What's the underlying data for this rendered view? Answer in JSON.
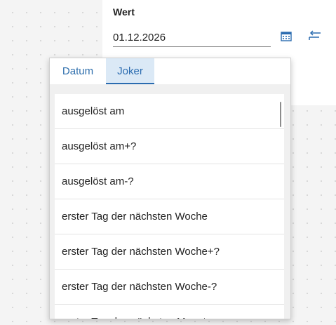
{
  "field": {
    "label": "Wert",
    "value": "01.12.2026"
  },
  "icons": {
    "calendar": "calendar-icon",
    "swap": "swap-arrow-icon"
  },
  "colors": {
    "accent": "#2b6cb0",
    "active_tab_bg": "#dbe9f6"
  },
  "popup": {
    "tabs": [
      {
        "label": "Datum",
        "active": false
      },
      {
        "label": "Joker",
        "active": true
      }
    ],
    "items": [
      "ausgelöst am",
      "ausgelöst am+?",
      "ausgelöst am-?",
      "erster Tag der nächsten Woche",
      "erster Tag der nächsten Woche+?",
      "erster Tag der nächsten Woche-?",
      "erster Tag des nächsten Monats"
    ]
  }
}
